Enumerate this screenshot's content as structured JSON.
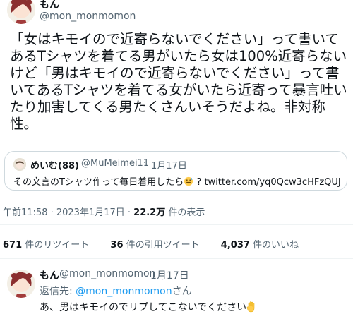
{
  "tweet": {
    "author_name": "もん",
    "author_handle": "@mon_monmomon",
    "text": "「女はキモイので近寄らないでください」って書いてあるTシャツを着てる男がいたら女は100%近寄らないけど「男はキモイので近寄らないでください」って書いてあるTシャツを着てる女がいたら近寄って暴言吐いたり加害してくる男たくさんいそうだよね。非対称性。",
    "timestamp": "午前11:58 · 2023年1月17日 · ",
    "views_count": "22.2万",
    "views_label": " 件の表示",
    "retweets_count": "671",
    "retweets_label": " 件のリツイート",
    "quotes_count": "36",
    "quotes_label": " 件の引用ツイート",
    "likes_count": "4,037",
    "likes_label": " 件のいいね"
  },
  "quoted_tweet": {
    "author_name": "めいむ(88)",
    "author_handle": "@MuMeimei11",
    "separator": "·",
    "date": "1月17日",
    "text": "その文言のTシャツ作って毎日着用したら",
    "emoji": "grinning-sweat-emoji",
    "text_after": " ? twitter.com/yq0Qcw3cHFzQUJ..."
  },
  "reply": {
    "author_name": "もん",
    "author_handle": "@mon_monmomon",
    "separator": "·",
    "date": "1月17日",
    "replying_prefix": "返信先: ",
    "replying_handle": "@mon_monmomon",
    "replying_suffix": "さん",
    "text": "あ、男はキモイのでリプしてこないでください",
    "emoji": "raised-hand-emoji"
  }
}
